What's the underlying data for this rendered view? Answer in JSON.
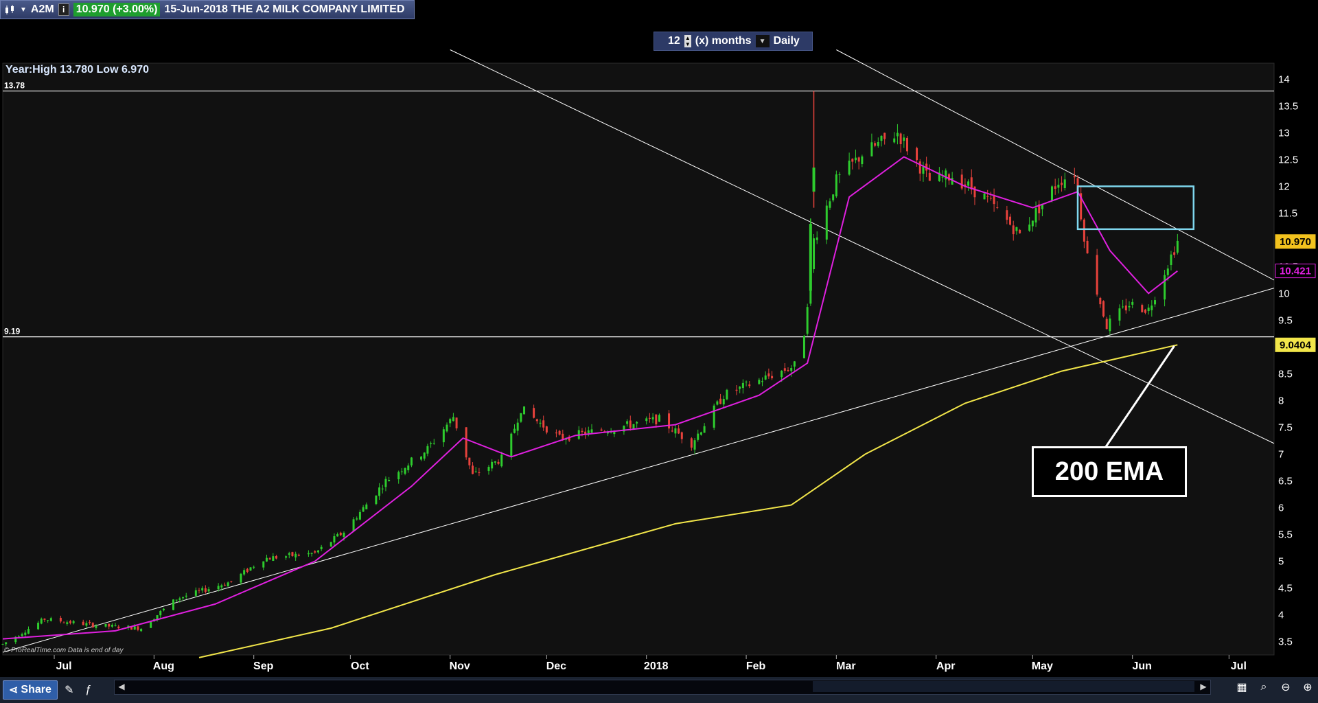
{
  "header": {
    "ticker": "A2M",
    "price_change": "10.970 (+3.00%)",
    "description": "15-Jun-2018 THE A2 MILK COMPANY LIMITED"
  },
  "controls": {
    "period_value": "12",
    "period_unit": "(x) months",
    "interval": "Daily"
  },
  "chart_header": "Year:High 13.780 Low 6.970",
  "watermark": "© ProRealTime.com  Data is end of day",
  "annotation": "200 EMA",
  "toolbar": {
    "share_label": "Share"
  },
  "colors": {
    "background": "#000000",
    "up_candle": "#2ecc2e",
    "down_candle": "#e8423c",
    "ema_short": "#e020e0",
    "ema_200": "#f2e64a",
    "trendline": "#ffffff",
    "highlight_box": "#7fd7ee",
    "price_tag": "#f2c21e"
  },
  "chart_data": {
    "type": "candlestick",
    "y_ticks": [
      "3.5",
      "4",
      "4.5",
      "5",
      "5.5",
      "6",
      "6.5",
      "7",
      "7.5",
      "8",
      "8.5",
      "9",
      "9.5",
      "10",
      "10.5",
      "11",
      "11.5",
      "12",
      "12.5",
      "13",
      "13.5",
      "14"
    ],
    "ylim": [
      3.25,
      14.3
    ],
    "x_ticks": [
      "Jul",
      "Aug",
      "Sep",
      "Oct",
      "Nov",
      "Dec",
      "2018",
      "Feb",
      "Mar",
      "Apr",
      "May",
      "Jun",
      "Jul"
    ],
    "horizontal_lines": [
      {
        "label": "13.78",
        "value": 13.78
      },
      {
        "label": "9.19",
        "value": 9.19
      }
    ],
    "price_tags": [
      {
        "label": "10.970",
        "value": 10.97,
        "color": "#f2c21e"
      },
      {
        "label": "10.421",
        "value": 10.421,
        "color": "#e020e0"
      },
      {
        "label": "9.0404",
        "value": 9.0404,
        "color": "#f2e64a"
      }
    ],
    "candle_trend": [
      [
        "2017-06-15",
        3.45
      ],
      [
        "2017-06-28",
        3.92
      ],
      [
        "2017-07-14",
        3.8
      ],
      [
        "2017-07-28",
        3.75
      ],
      [
        "2017-08-08",
        4.3
      ],
      [
        "2017-08-25",
        4.62
      ],
      [
        "2017-09-04",
        5.05
      ],
      [
        "2017-09-20",
        5.15
      ],
      [
        "2017-09-29",
        5.55
      ],
      [
        "2017-10-12",
        6.5
      ],
      [
        "2017-10-25",
        7.1
      ],
      [
        "2017-11-02",
        7.7
      ],
      [
        "2017-11-08",
        6.6
      ],
      [
        "2017-11-18",
        6.95
      ],
      [
        "2017-11-23",
        7.85
      ],
      [
        "2017-12-05",
        7.3
      ],
      [
        "2017-12-18",
        7.45
      ],
      [
        "2018-01-05",
        7.65
      ],
      [
        "2018-01-15",
        7.2
      ],
      [
        "2018-01-25",
        8.1
      ],
      [
        "2018-02-06",
        8.4
      ],
      [
        "2018-02-18",
        8.7
      ],
      [
        "2018-02-22",
        11.0
      ],
      [
        "2018-03-01",
        12.1
      ],
      [
        "2018-03-09",
        12.6
      ],
      [
        "2018-03-20",
        13.0
      ],
      [
        "2018-03-30",
        12.1
      ],
      [
        "2018-04-06",
        12.2
      ],
      [
        "2018-04-16",
        11.8
      ],
      [
        "2018-04-27",
        11.1
      ],
      [
        "2018-05-09",
        12.1
      ],
      [
        "2018-05-14",
        12.25
      ],
      [
        "2018-05-18",
        10.7
      ],
      [
        "2018-05-24",
        9.4
      ],
      [
        "2018-05-31",
        9.8
      ],
      [
        "2018-06-06",
        9.7
      ],
      [
        "2018-06-13",
        10.7
      ],
      [
        "2018-06-15",
        10.97
      ]
    ],
    "special_candles": [
      {
        "date": "2018-02-22",
        "low": 11.6,
        "high": 13.78,
        "open": 11.9,
        "close": 12.35
      },
      {
        "date": "2018-02-21",
        "low": 10.0,
        "high": 11.4,
        "open": 10.05,
        "close": 11.3
      }
    ],
    "ema_short": [
      [
        "2017-06-15",
        3.55
      ],
      [
        "2017-07-20",
        3.7
      ],
      [
        "2017-08-20",
        4.2
      ],
      [
        "2017-09-20",
        5.0
      ],
      [
        "2017-10-20",
        6.4
      ],
      [
        "2017-11-05",
        7.3
      ],
      [
        "2017-11-20",
        6.95
      ],
      [
        "2017-12-10",
        7.35
      ],
      [
        "2018-01-10",
        7.55
      ],
      [
        "2018-02-05",
        8.1
      ],
      [
        "2018-02-20",
        8.7
      ],
      [
        "2018-03-05",
        11.8
      ],
      [
        "2018-03-22",
        12.55
      ],
      [
        "2018-04-10",
        12.0
      ],
      [
        "2018-05-01",
        11.6
      ],
      [
        "2018-05-15",
        11.9
      ],
      [
        "2018-05-25",
        10.8
      ],
      [
        "2018-06-06",
        10.0
      ],
      [
        "2018-06-15",
        10.42
      ]
    ],
    "ema_200": [
      [
        "2017-08-15",
        3.2
      ],
      [
        "2017-09-25",
        3.75
      ],
      [
        "2017-11-15",
        4.75
      ],
      [
        "2018-01-10",
        5.7
      ],
      [
        "2018-02-15",
        6.05
      ],
      [
        "2018-03-10",
        7.0
      ],
      [
        "2018-04-10",
        7.95
      ],
      [
        "2018-05-10",
        8.55
      ],
      [
        "2018-06-15",
        9.04
      ]
    ],
    "trendlines": [
      {
        "from": [
          "2017-06-15",
          3.3
        ],
        "to": [
          "2018-07-15",
          10.1
        ]
      },
      {
        "from": [
          "2017-11-01",
          14.55
        ],
        "to": [
          "2018-07-15",
          7.2
        ]
      },
      {
        "from": [
          "2018-03-01",
          14.55
        ],
        "to": [
          "2018-07-15",
          10.25
        ]
      }
    ],
    "highlight_box": {
      "from": [
        "2018-05-15",
        11.2
      ],
      "to": [
        "2018-06-20",
        12.0
      ]
    },
    "annotation_pointer": {
      "to": [
        "2018-06-14",
        9.02
      ]
    }
  }
}
